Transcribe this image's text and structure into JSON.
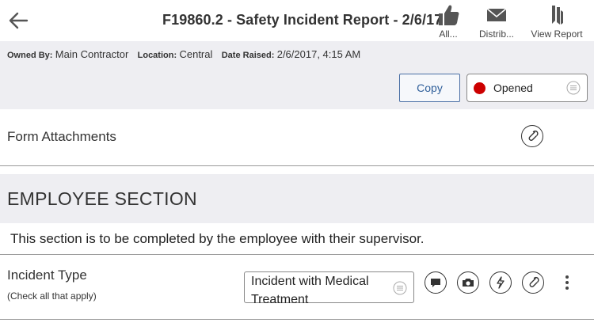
{
  "header": {
    "title": "F19860.2 - Safety Incident Report - 2/6/17",
    "actions": [
      {
        "label": "All...",
        "icon": "thumbs-up-icon"
      },
      {
        "label": "Distrib...",
        "icon": "envelope-icon"
      },
      {
        "label": "View Report",
        "icon": "report-icon"
      }
    ]
  },
  "meta": {
    "owned_by_label": "Owned By:",
    "owned_by": "Main Contractor",
    "location_label": "Location:",
    "location": "Central",
    "date_label": "Date Raised:",
    "date": "2/6/2017, 4:15 AM"
  },
  "toolbar": {
    "copy_label": "Copy",
    "status": "Opened",
    "status_color": "#cc0000"
  },
  "attachments": {
    "label": "Form Attachments"
  },
  "section": {
    "title": "EMPLOYEE SECTION",
    "note": "This section is to be completed by the employee with their supervisor."
  },
  "field": {
    "label": "Incident Type",
    "sublabel": "(Check all that apply)",
    "value": "Incident with Medical Treatment"
  }
}
